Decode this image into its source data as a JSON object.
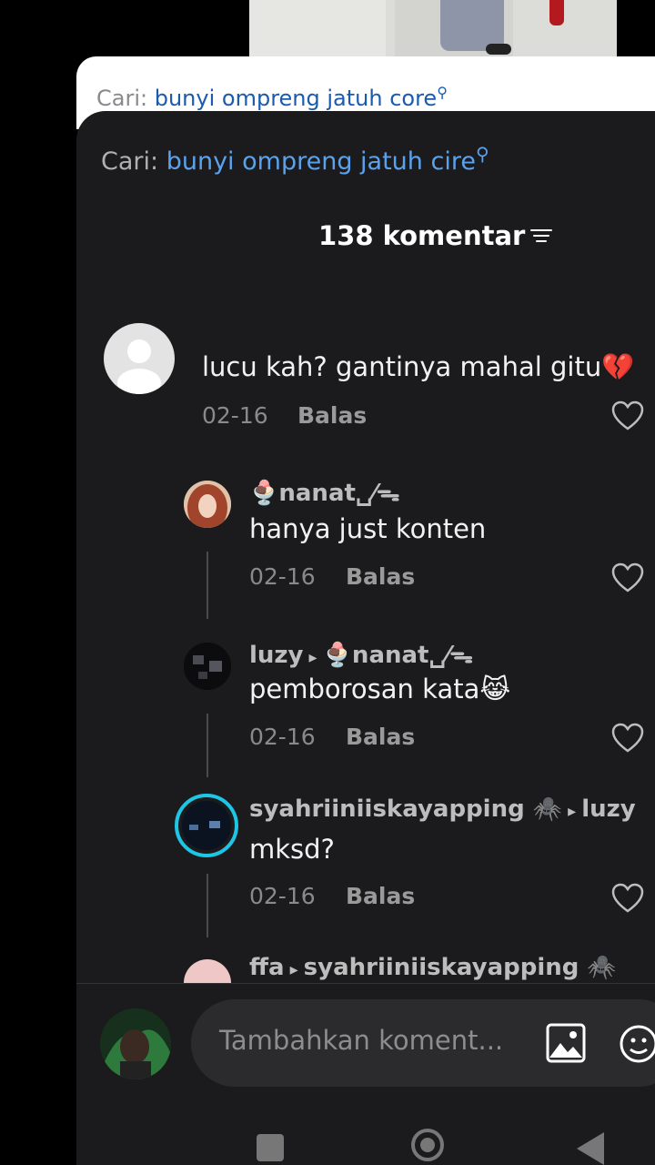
{
  "white_search": {
    "prefix": "Cari:",
    "query": "bunyi ompreng jatuh core",
    "icon": "search-icon"
  },
  "search": {
    "prefix": "Cari:",
    "query": "bunyi ompreng jatuh cire",
    "icon": "search-icon"
  },
  "header": {
    "count_title": "138 komentar",
    "sort_icon": "sort-icon"
  },
  "comments": [
    {
      "username": "",
      "text": "lucu kah? gantinya mahal gitu💔",
      "date": "02-16",
      "reply_label": "Balas"
    },
    {
      "username": "🍨nanat␣⁄ᯓ",
      "text": "hanya just konten",
      "date": "02-16",
      "reply_label": "Balas"
    },
    {
      "username": "luzy",
      "reply_to": "🍨nanat␣⁄ᯓ",
      "text": "pemborosan kata😹",
      "date": "02-16",
      "reply_label": "Balas"
    },
    {
      "username": "syahriiniiskayapping 🕷️",
      "reply_to": "luzy",
      "text": "mksd?",
      "date": "02-16",
      "reply_label": "Balas"
    },
    {
      "username": "ffa",
      "reply_to": "syahriiniiskayapping 🕷️"
    }
  ],
  "input": {
    "placeholder": "Tambahkan koment..."
  },
  "colors": {
    "sheet_bg": "#1b1b1d",
    "link_blue": "#5aa3ec",
    "story_ring": "#1ec6e6"
  }
}
